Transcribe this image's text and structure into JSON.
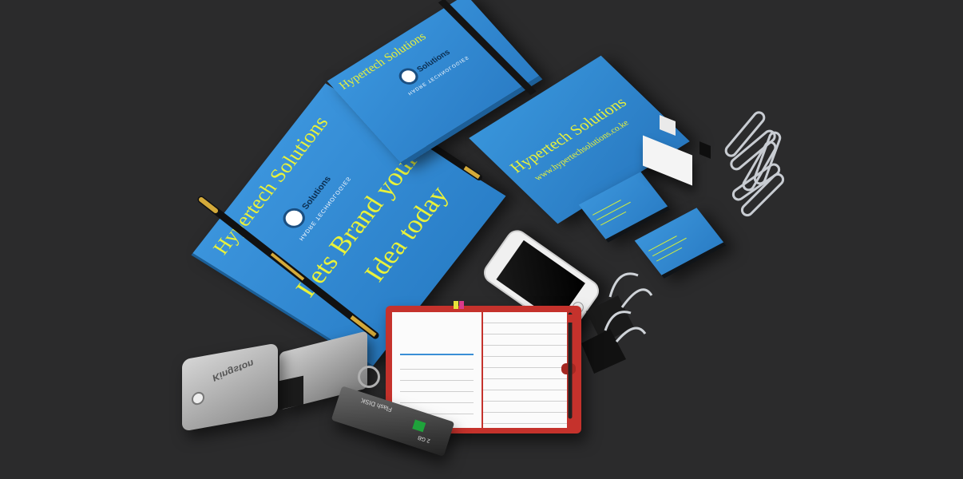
{
  "folder": {
    "company": "Hypertech Solutions",
    "logo_word": "Solutions",
    "logo_sub": "HADRE TECHNOLOGIES",
    "slogan_line1": "Lets Brand your",
    "slogan_line2": "Idea today"
  },
  "notebook": {
    "company": "Hypertech Solutions",
    "logo_word": "Solutions",
    "logo_sub": "HADRE TECHNOLOGIES"
  },
  "envelope": {
    "company": "Hypertech Solutions",
    "url": "www.hypertechsolutions.co.ke"
  },
  "usb": {
    "brand": "Kingston",
    "flash_label": "Flash DISK",
    "flash_capacity": "2 GB"
  },
  "colors": {
    "background": "#2b2b2c",
    "brand_blue": "#2e86d0",
    "slogan_yellow": "#e9f23a",
    "planner_red": "#c5322c"
  }
}
